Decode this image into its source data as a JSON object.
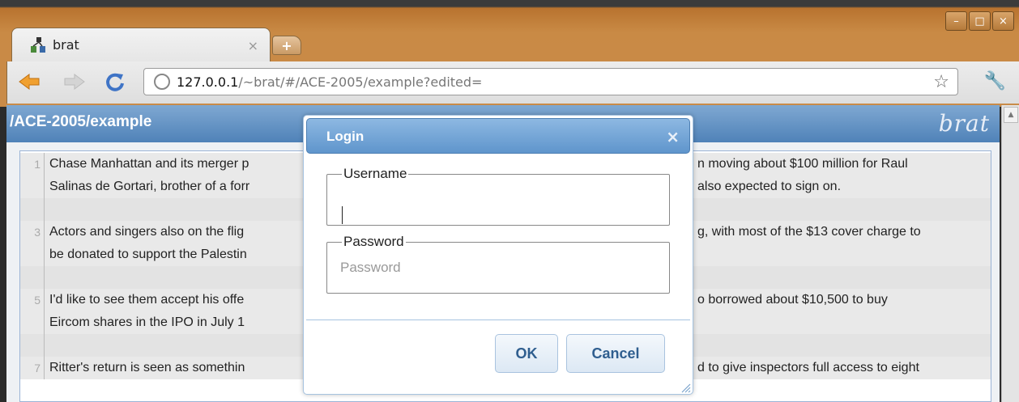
{
  "browser": {
    "tab_title": "brat",
    "tab_close": "×",
    "new_tab": "+",
    "url_host": "127.0.0.1",
    "url_path": "/~brat/#/ACE-2005/example?edited=",
    "window_controls": [
      "–",
      "□",
      "×"
    ]
  },
  "page": {
    "path": "/ACE-2005/example",
    "logo": "brat"
  },
  "document": {
    "lines": [
      {
        "num": "1",
        "text": "Chase Manhattan and its merger p"
      },
      {
        "num": "",
        "text": "Salinas de Gortari, brother of a forr"
      },
      {
        "num": "",
        "text": ""
      },
      {
        "num": "3",
        "text": "Actors and singers also on the flig"
      },
      {
        "num": "",
        "text": "be donated to support the Palestin"
      },
      {
        "num": "",
        "text": ""
      },
      {
        "num": "5",
        "text": "I'd like to see them accept his offe"
      },
      {
        "num": "",
        "text": "Eircom shares in the IPO in July 1"
      },
      {
        "num": "",
        "text": ""
      },
      {
        "num": "7",
        "text": "Ritter's return is seen as somethin"
      }
    ],
    "right_lines": [
      "n moving about $100 million for Raul",
      "also expected to sign on.",
      "",
      "g, with most of the $13 cover charge to",
      "",
      "",
      "o borrowed about $10,500 to buy",
      "",
      "",
      "d to give inspectors full access to eight"
    ]
  },
  "dialog": {
    "title": "Login",
    "close": "×",
    "username_label": "Username",
    "username_value": "",
    "password_label": "Password",
    "password_placeholder": "Password",
    "ok_label": "OK",
    "cancel_label": "Cancel"
  },
  "colors": {
    "chrome_orange": "#c98a45",
    "header_blue": "#5f95cc",
    "button_text": "#2f5e8f"
  }
}
